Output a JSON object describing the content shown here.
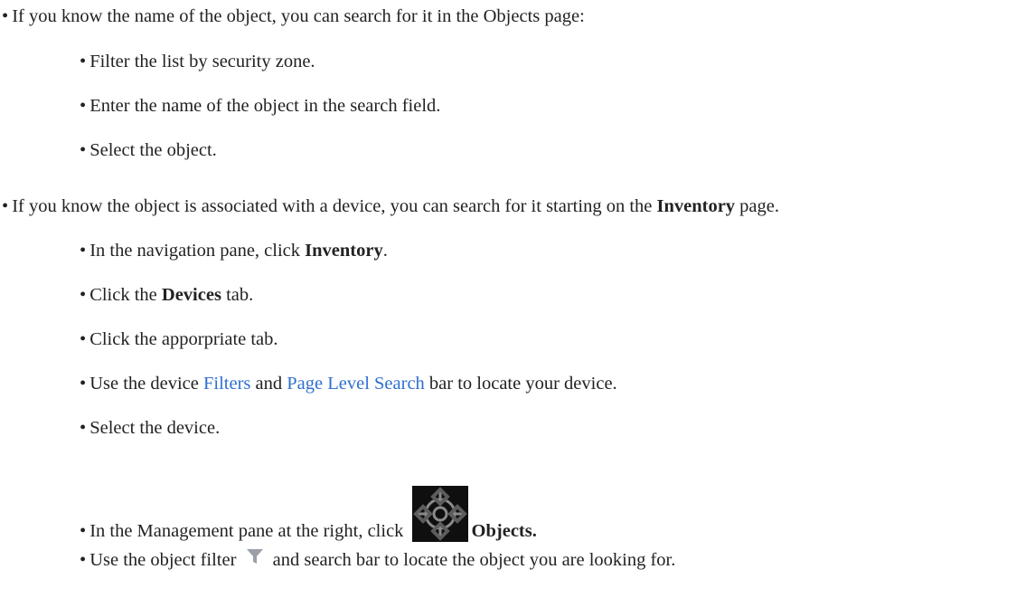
{
  "list": {
    "bullet": "•",
    "item1": {
      "text": "If you know the name of the object, you can search for it in the Objects page:",
      "sub": [
        "Filter the list by security zone.",
        "Enter the name of the object in the search field.",
        "Select the object."
      ]
    },
    "item2": {
      "text_before": "If you know the object is associated with a device, you can search for it starting on the ",
      "bold": "Inventory",
      "text_after": " page.",
      "sub_nav": {
        "before": "In the navigation pane, click ",
        "bold": "Inventory",
        "after": "."
      },
      "sub_devices": {
        "before": "Click the ",
        "bold": "Devices",
        "after": " tab."
      },
      "sub_tab": "Click the apporpriate tab.",
      "sub_filters": {
        "before": "Use the device ",
        "link1": "Filters",
        "middle": " and ",
        "link2": "Page Level Search",
        "after": " bar to locate your device."
      },
      "sub_select": "Select the device.",
      "sub_mgmt": {
        "before": "In the Management pane at the right, click ",
        "icon": "objects-crosshair-icon",
        "bold": "Objects."
      },
      "sub_filter_icon": {
        "before": "Use the object filter ",
        "icon": "filter-funnel-icon",
        "after": " and search bar to locate the object you are looking for."
      }
    }
  },
  "colors": {
    "text": "#222222",
    "link": "#2f6fd1"
  }
}
